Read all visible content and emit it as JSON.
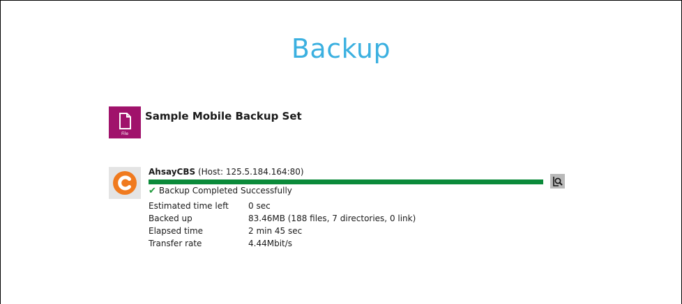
{
  "page": {
    "title": "Backup"
  },
  "backup_set": {
    "name": "Sample Mobile Backup Set",
    "icon": "file-icon",
    "icon_tag": "File",
    "icon_color": "#a0126b"
  },
  "destination": {
    "server_name": "AhsayCBS",
    "host_text": "(Host: 125.5.184.164:80)",
    "icon": "ahsay-logo-icon",
    "progress_fraction": 1.0,
    "progress_color": "#0b8a3a",
    "status": "Backup Completed Successfully",
    "status_icon": "check-icon",
    "log_button_icon": "magnifier-log-icon",
    "stats": [
      {
        "label": "Estimated time left",
        "value": "0 sec"
      },
      {
        "label": "Backed up",
        "value": "83.46MB (188 files, 7 directories, 0 link)"
      },
      {
        "label": "Elapsed time",
        "value": "2 min 45 sec"
      },
      {
        "label": "Transfer rate",
        "value": "4.44Mbit/s"
      }
    ]
  },
  "colors": {
    "title": "#3bb0e0",
    "accent_orange": "#f07a1e"
  }
}
